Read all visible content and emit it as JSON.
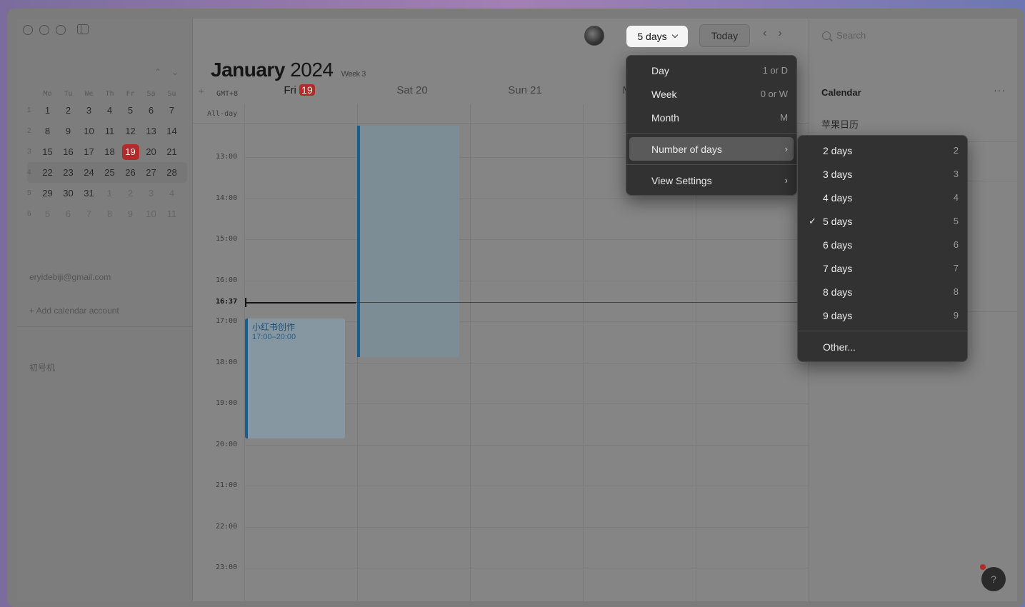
{
  "sidebar": {
    "weekday_headers": [
      "Mo",
      "Tu",
      "We",
      "Th",
      "Fr",
      "Sa",
      "Su"
    ],
    "weeks": [
      {
        "wk": "1",
        "days": [
          "1",
          "2",
          "3",
          "4",
          "5",
          "6",
          "7"
        ]
      },
      {
        "wk": "2",
        "days": [
          "8",
          "9",
          "10",
          "11",
          "12",
          "13",
          "14"
        ]
      },
      {
        "wk": "3",
        "days": [
          "15",
          "16",
          "17",
          "18",
          "19",
          "20",
          "21"
        ]
      },
      {
        "wk": "4",
        "days": [
          "22",
          "23",
          "24",
          "25",
          "26",
          "27",
          "28"
        ]
      },
      {
        "wk": "5",
        "days": [
          "29",
          "30",
          "31",
          "1",
          "2",
          "3",
          "4"
        ]
      },
      {
        "wk": "6",
        "days": [
          "5",
          "6",
          "7",
          "8",
          "9",
          "10",
          "11"
        ]
      }
    ],
    "account_email": "eryidebiji@gmail.com",
    "add_account_label": "+ Add calendar account",
    "device_label": "初号机"
  },
  "header": {
    "month_bold": "January",
    "year": "2024",
    "week_label": "Week 3",
    "view_button_label": "5 days",
    "today_label": "Today",
    "prev_icon": "‹",
    "next_icon": "›",
    "timezone": "GMT+8",
    "add_icon": "+",
    "allday_label": "All-day"
  },
  "days": [
    {
      "name": "Fri",
      "num": "19"
    },
    {
      "name": "Sat",
      "num": "20"
    },
    {
      "name": "Sun",
      "num": "21"
    },
    {
      "name": "M",
      "num": ""
    }
  ],
  "hours": [
    "13:00",
    "14:00",
    "15:00",
    "16:00",
    "17:00",
    "18:00",
    "19:00",
    "20:00",
    "21:00",
    "22:00",
    "23:00"
  ],
  "now_label": "16:37",
  "event": {
    "title": "小红书创作",
    "time": "17:00–20:00"
  },
  "right_panel": {
    "search_placeholder": "Search",
    "calendar_title": "Calendar",
    "more_icon": "···",
    "calendar_name": "苹果日历",
    "help_icon": "?"
  },
  "view_menu": {
    "items": [
      {
        "label": "Day",
        "shortcut": "1 or D"
      },
      {
        "label": "Week",
        "shortcut": "0 or W"
      },
      {
        "label": "Month",
        "shortcut": "M"
      }
    ],
    "number_of_days_label": "Number of days",
    "view_settings_label": "View Settings",
    "submenu_arrow": "›"
  },
  "days_submenu": {
    "items": [
      {
        "label": "2 days",
        "shortcut": "2",
        "checked": false
      },
      {
        "label": "3 days",
        "shortcut": "3",
        "checked": false
      },
      {
        "label": "4 days",
        "shortcut": "4",
        "checked": false
      },
      {
        "label": "5 days",
        "shortcut": "5",
        "checked": true
      },
      {
        "label": "6 days",
        "shortcut": "6",
        "checked": false
      },
      {
        "label": "7 days",
        "shortcut": "7",
        "checked": false
      },
      {
        "label": "8 days",
        "shortcut": "8",
        "checked": false
      },
      {
        "label": "9 days",
        "shortcut": "9",
        "checked": false
      }
    ],
    "other_label": "Other...",
    "check_mark": "✓"
  }
}
